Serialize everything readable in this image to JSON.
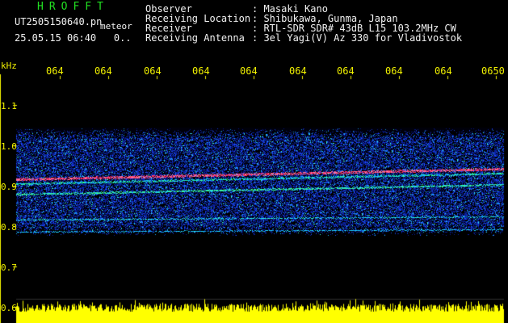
{
  "header": {
    "brand": "HROFFT",
    "filename": "UT2505150640.pn",
    "meteor_label": "meteor",
    "datetime": "25.05.15 06:40",
    "datetime_suffix": "0.."
  },
  "meta": [
    {
      "label": "Observer",
      "value": ": Masaki Kano"
    },
    {
      "label": "Receiving Location",
      "value": ": Shibukawa, Gunma, Japan"
    },
    {
      "label": "Receiver",
      "value": ": RTL-SDR SDR# 43dB L15 103.2MHz CW"
    },
    {
      "label": "Receiving Antenna",
      "value": ": 3el Yagi(V) Az 330 for Vladivostok"
    }
  ],
  "axis": {
    "unit": "kHz",
    "y_ticks": [
      "1.1",
      "1.0",
      "0.9",
      "0.8",
      "0.7",
      "0.6"
    ],
    "x_ticks": [
      "064",
      "064",
      "064",
      "064",
      "064",
      "064",
      "064",
      "064",
      "064",
      "0650"
    ]
  },
  "colors": {
    "label": "#f0f000",
    "text": "#f2f2f2",
    "brand": "#22e022",
    "noise": "#1a3cff",
    "signal": "#ff3060",
    "amplitude": "#ffff00"
  }
}
